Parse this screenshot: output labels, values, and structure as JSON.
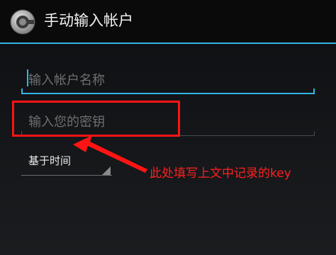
{
  "header": {
    "title": "手动输入帐户",
    "icon": "authenticator-app-icon"
  },
  "form": {
    "account_placeholder": "输入帐户名称",
    "secret_placeholder": "输入您的密钥",
    "type_selected": "基于时间"
  },
  "annotation": {
    "text": "此处填写上文中记录的key",
    "color": "#ff2020"
  },
  "colors": {
    "accent": "#33b5e5",
    "highlight": "#ff1414"
  }
}
